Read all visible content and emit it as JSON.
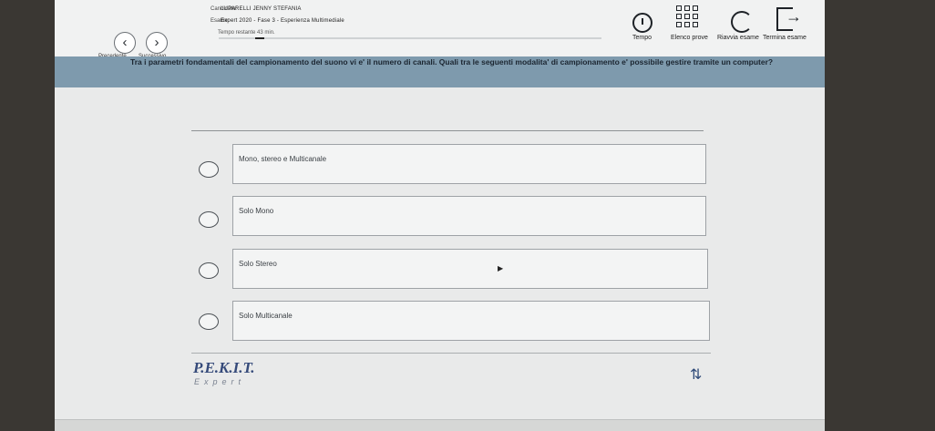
{
  "nav": {
    "prev_icon": "chevron-left-icon",
    "next_icon": "chevron-right-icon",
    "prev_label": "Precedente",
    "next_label": "Successivo"
  },
  "meta": {
    "candidate_label": "Candidato:",
    "candidate_value": "LUPARELLI JENNY STEFANIA",
    "exam_label": "Esame:",
    "exam_value": "Expert 2020 - Fase 3 - Esperienza Multimediale",
    "time_left": "Tempo restante 43 min.",
    "progress": 0.02
  },
  "tools": [
    {
      "icon": "clock-icon",
      "label": "Tempo"
    },
    {
      "icon": "grid-list-icon",
      "label": "Elenco prove"
    },
    {
      "icon": "reload-icon",
      "label": "Riavvia esame"
    },
    {
      "icon": "exit-icon",
      "label": "Termina esame"
    }
  ],
  "question": "Tra i parametri fondamentali del campionamento del suono vi e' il numero di canali. Quali tra le seguenti modalita' di campionamento e' possibile gestire tramite un computer?",
  "answers": [
    {
      "text": "Mono, stereo e Multicanale"
    },
    {
      "text": "Solo Mono"
    },
    {
      "text": "Solo Stereo"
    },
    {
      "text": "Solo Multicanale"
    }
  ],
  "footer": {
    "logo": "P.E.K.I.T.",
    "logo_sub": "Expert",
    "switch_icon": "switch-arrows-icon"
  }
}
